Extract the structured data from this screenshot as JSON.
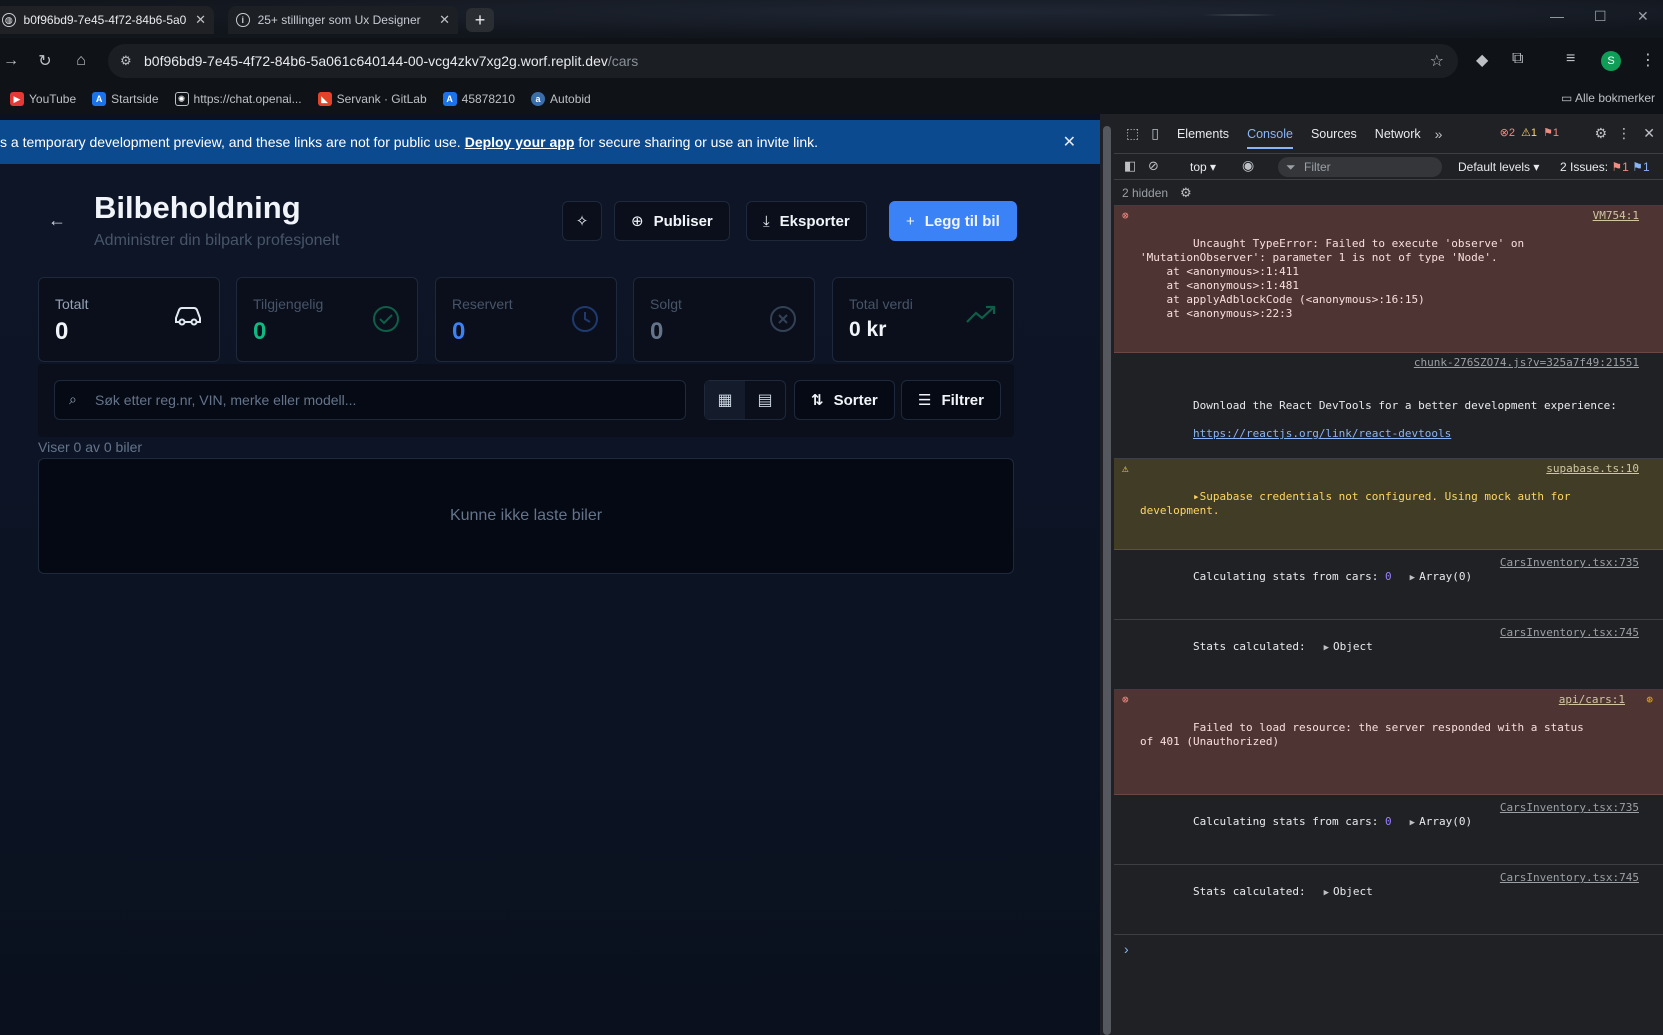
{
  "browser": {
    "tabs": [
      {
        "title": "b0f96bd9-7e45-4f72-84b6-5a0"
      },
      {
        "title": "25+ stillinger som Ux Designer"
      }
    ],
    "new_tab_label": "+",
    "url_host": "b0f96bd9-7e45-4f72-84b6-5a061c640144-00-vcg4zkv7xg2g.worf.replit.dev",
    "url_path": "/cars",
    "profile_initial": "S",
    "bookmarks": [
      "YouTube",
      "Startside",
      "https://chat.openai...",
      "Servank · GitLab",
      "45878210",
      "Autobid"
    ],
    "all_bookmarks_label": "Alle bokmerker"
  },
  "banner": {
    "text_before": "s a temporary development preview, and these links are not for public use.",
    "link": "Deploy your app",
    "text_after": "for secure sharing or use an invite link."
  },
  "page": {
    "title": "Bilbeholdning",
    "subtitle": "Administrer din bilpark profesjonelt",
    "buttons": {
      "publish": "Publiser",
      "export": "Eksporter",
      "add": "Legg til bil"
    },
    "stats": [
      {
        "label": "Totalt",
        "value": "0",
        "color": "#f1f5f9"
      },
      {
        "label": "Tilgjengelig",
        "value": "0",
        "color": "#10b981"
      },
      {
        "label": "Reservert",
        "value": "0",
        "color": "#3b82f6"
      },
      {
        "label": "Solgt",
        "value": "0",
        "color": "#64748b"
      },
      {
        "label": "Total verdi",
        "value": "0 kr",
        "color": "#f1f5f9"
      }
    ],
    "search_placeholder": "Søk etter reg.nr, VIN, merke eller modell...",
    "sort_label": "Sorter",
    "filter_label": "Filtrer",
    "count_text": "Viser 0 av 0 biler",
    "empty_text": "Kunne ikke laste biler"
  },
  "devtools": {
    "tabs": [
      "Elements",
      "Console",
      "Sources",
      "Network"
    ],
    "active_tab": "Console",
    "counts": {
      "errors": "2",
      "warnings": "1",
      "issues": "1"
    },
    "context": "top",
    "filter_placeholder": "Filter",
    "levels": "Default levels",
    "issues_label": "2 Issues:",
    "issues_err": "1",
    "issues_info": "1",
    "hidden": "2 hidden",
    "messages": [
      {
        "type": "error",
        "source": "VM754:1",
        "text": "Uncaught TypeError: Failed to execute 'observe' on\n'MutationObserver': parameter 1 is not of type 'Node'.\n    at <anonymous>:1:411\n    at <anonymous>:1:481\n    at applyAdblockCode (<anonymous>:16:15)\n    at <anonymous>:22:3"
      },
      {
        "type": "info",
        "source": "chunk-276SZO74.js?v=325a7f49:21551",
        "text": "Download the React DevTools for a better development experience:",
        "link": "https://reactjs.org/link/react-devtools"
      },
      {
        "type": "warn",
        "source": "supabase.ts:10",
        "text": "Supabase credentials not configured. Using mock auth for\ndevelopment."
      },
      {
        "type": "log",
        "source": "CarsInventory.tsx:735",
        "text": "Calculating stats from cars:",
        "num": "0",
        "obj": "Array(0)"
      },
      {
        "type": "log",
        "source": "CarsInventory.tsx:745",
        "text": "Stats calculated:",
        "obj": "Object"
      },
      {
        "type": "error",
        "source": "api/cars:1",
        "text": "Failed to load resource: the server responded with a status\nof 401 (Unauthorized)"
      },
      {
        "type": "log",
        "source": "CarsInventory.tsx:735",
        "text": "Calculating stats from cars:",
        "num": "0",
        "obj": "Array(0)"
      },
      {
        "type": "log",
        "source": "CarsInventory.tsx:745",
        "text": "Stats calculated:",
        "obj": "Object"
      }
    ]
  }
}
